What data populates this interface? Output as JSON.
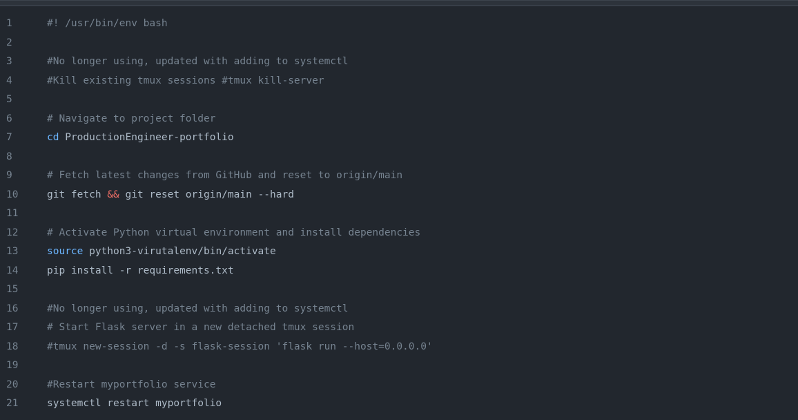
{
  "theme": {
    "background": "#22272e",
    "line_number_color": "#768390",
    "comment_color": "#768390",
    "builtin_color": "#6cb6ff",
    "operator_color": "#f47067",
    "text_color": "#adbac7"
  },
  "lines": [
    {
      "number": "1",
      "tokens": [
        {
          "type": "comment",
          "text": "#! /usr/bin/env bash"
        }
      ]
    },
    {
      "number": "2",
      "tokens": []
    },
    {
      "number": "3",
      "tokens": [
        {
          "type": "comment",
          "text": "#No longer using, updated with adding to systemctl"
        }
      ]
    },
    {
      "number": "4",
      "tokens": [
        {
          "type": "comment",
          "text": "#Kill existing tmux sessions #tmux kill-server"
        }
      ]
    },
    {
      "number": "5",
      "tokens": []
    },
    {
      "number": "6",
      "tokens": [
        {
          "type": "comment",
          "text": "# Navigate to project folder"
        }
      ]
    },
    {
      "number": "7",
      "tokens": [
        {
          "type": "builtin",
          "text": "cd"
        },
        {
          "type": "plain",
          "text": " ProductionEngineer-portfolio"
        }
      ]
    },
    {
      "number": "8",
      "tokens": []
    },
    {
      "number": "9",
      "tokens": [
        {
          "type": "comment",
          "text": "# Fetch latest changes from GitHub and reset to origin/main"
        }
      ]
    },
    {
      "number": "10",
      "tokens": [
        {
          "type": "plain",
          "text": "git fetch "
        },
        {
          "type": "op",
          "text": "&&"
        },
        {
          "type": "plain",
          "text": " git reset origin/main --hard"
        }
      ]
    },
    {
      "number": "11",
      "tokens": []
    },
    {
      "number": "12",
      "tokens": [
        {
          "type": "comment",
          "text": "# Activate Python virtual environment and install dependencies"
        }
      ]
    },
    {
      "number": "13",
      "tokens": [
        {
          "type": "builtin",
          "text": "source"
        },
        {
          "type": "plain",
          "text": " python3-virutalenv/bin/activate"
        }
      ]
    },
    {
      "number": "14",
      "tokens": [
        {
          "type": "plain",
          "text": "pip install -r requirements.txt"
        }
      ]
    },
    {
      "number": "15",
      "tokens": []
    },
    {
      "number": "16",
      "tokens": [
        {
          "type": "comment",
          "text": "#No longer using, updated with adding to systemctl"
        }
      ]
    },
    {
      "number": "17",
      "tokens": [
        {
          "type": "comment",
          "text": "# Start Flask server in a new detached tmux session"
        }
      ]
    },
    {
      "number": "18",
      "tokens": [
        {
          "type": "comment",
          "text": "#tmux new-session -d -s flask-session 'flask run --host=0.0.0.0'"
        }
      ]
    },
    {
      "number": "19",
      "tokens": []
    },
    {
      "number": "20",
      "tokens": [
        {
          "type": "comment",
          "text": "#Restart myportfolio service"
        }
      ]
    },
    {
      "number": "21",
      "tokens": [
        {
          "type": "plain",
          "text": "systemctl restart myportfolio"
        }
      ]
    }
  ]
}
